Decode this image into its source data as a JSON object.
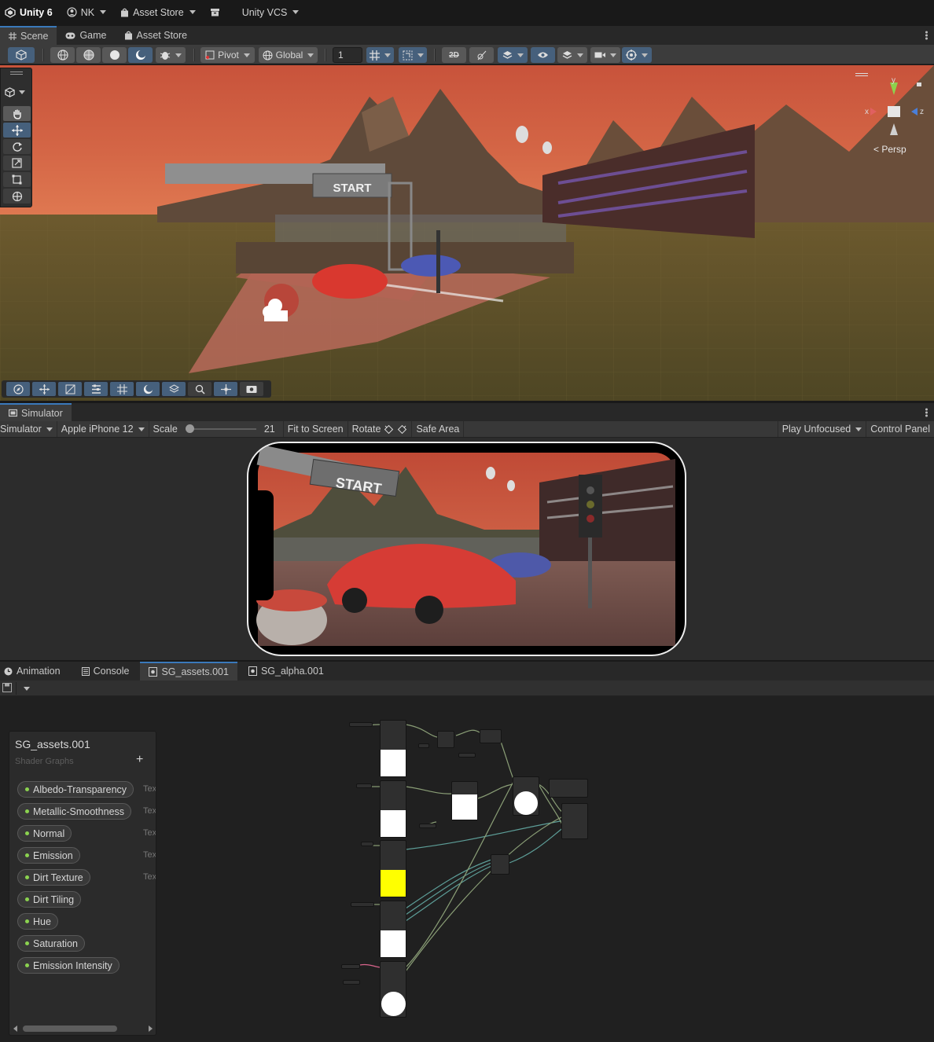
{
  "topbar": {
    "app": "Unity 6",
    "account": "NK",
    "asset_store": "Asset Store",
    "vcs": "Unity VCS"
  },
  "tabs": {
    "scene": "Scene",
    "game": "Game",
    "asset_store": "Asset Store"
  },
  "scene_toolbar": {
    "pivot": "Pivot",
    "global": "Global",
    "grid_increment": "1",
    "accent_color": "#46607c"
  },
  "scene_view": {
    "banner_text": "START",
    "camera_mode": "Persp",
    "axes": {
      "x": "x",
      "y": "y",
      "z": "z"
    }
  },
  "simulator": {
    "tab": "Simulator",
    "mode": "Simulator",
    "device": "Apple iPhone 12",
    "scale_label": "Scale",
    "scale_value": "21",
    "scale_fraction": 0.06,
    "fit_to_screen": "Fit to Screen",
    "rotate": "Rotate",
    "safe_area": "Safe Area",
    "play_mode": "Play Unfocused",
    "control_panel": "Control Panel",
    "banner_text": "START"
  },
  "bottom_tabs": {
    "animation": "Animation",
    "console": "Console",
    "sg_assets": "SG_assets.001",
    "sg_alpha": "SG_alpha.001"
  },
  "blackboard": {
    "title": "SG_assets.001",
    "subtitle": "Shader Graphs",
    "add": "+",
    "type_short": "Tex",
    "properties": [
      {
        "name": "Albedo-Transparency",
        "type": "Tex"
      },
      {
        "name": "Metallic-Smoothness",
        "type": "Tex"
      },
      {
        "name": "Normal",
        "type": "Tex"
      },
      {
        "name": "Emission",
        "type": "Tex"
      },
      {
        "name": "Dirt Texture",
        "type": "Tex"
      },
      {
        "name": "Dirt Tiling",
        "type": ""
      },
      {
        "name": "Hue",
        "type": ""
      },
      {
        "name": "Saturation",
        "type": ""
      },
      {
        "name": "Emission Intensity",
        "type": ""
      }
    ],
    "property_dot_color": "#8bd34f"
  },
  "graph": {
    "preview_colors": [
      "#ffffff",
      "#ffffff",
      "#ffff00",
      "#ffffff",
      "#ffffff"
    ]
  }
}
